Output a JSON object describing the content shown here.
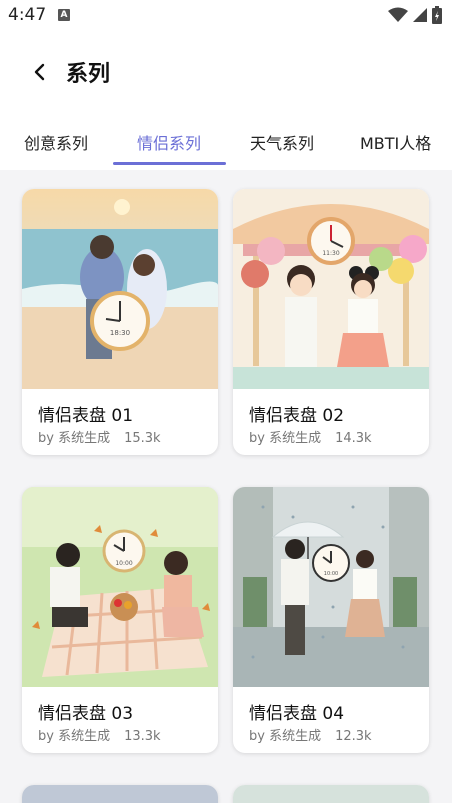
{
  "status_bar": {
    "time": "4:47",
    "notification_letter": "A"
  },
  "header": {
    "title": "系列"
  },
  "tabs": [
    {
      "label": "创意系列",
      "active": false
    },
    {
      "label": "情侣系列",
      "active": true
    },
    {
      "label": "天气系列",
      "active": false
    },
    {
      "label": "MBTI人格",
      "active": false
    }
  ],
  "cards": [
    {
      "title": "情侣表盘 01",
      "author": "by 系统生成",
      "count": "15.3k",
      "clock_text": "18:30",
      "scene": "beach"
    },
    {
      "title": "情侣表盘 02",
      "author": "by 系统生成",
      "count": "14.3k",
      "clock_text": "11:30",
      "scene": "carousel"
    },
    {
      "title": "情侣表盘 03",
      "author": "by 系统生成",
      "count": "13.3k",
      "clock_text": "10:00",
      "scene": "picnic"
    },
    {
      "title": "情侣表盘 04",
      "author": "by 系统生成",
      "count": "12.3k",
      "clock_text": "10:00",
      "scene": "rain"
    }
  ],
  "colors": {
    "accent": "#6b6fd6",
    "card_bg": "#ffffff",
    "page_bg": "#f4f4f6"
  }
}
